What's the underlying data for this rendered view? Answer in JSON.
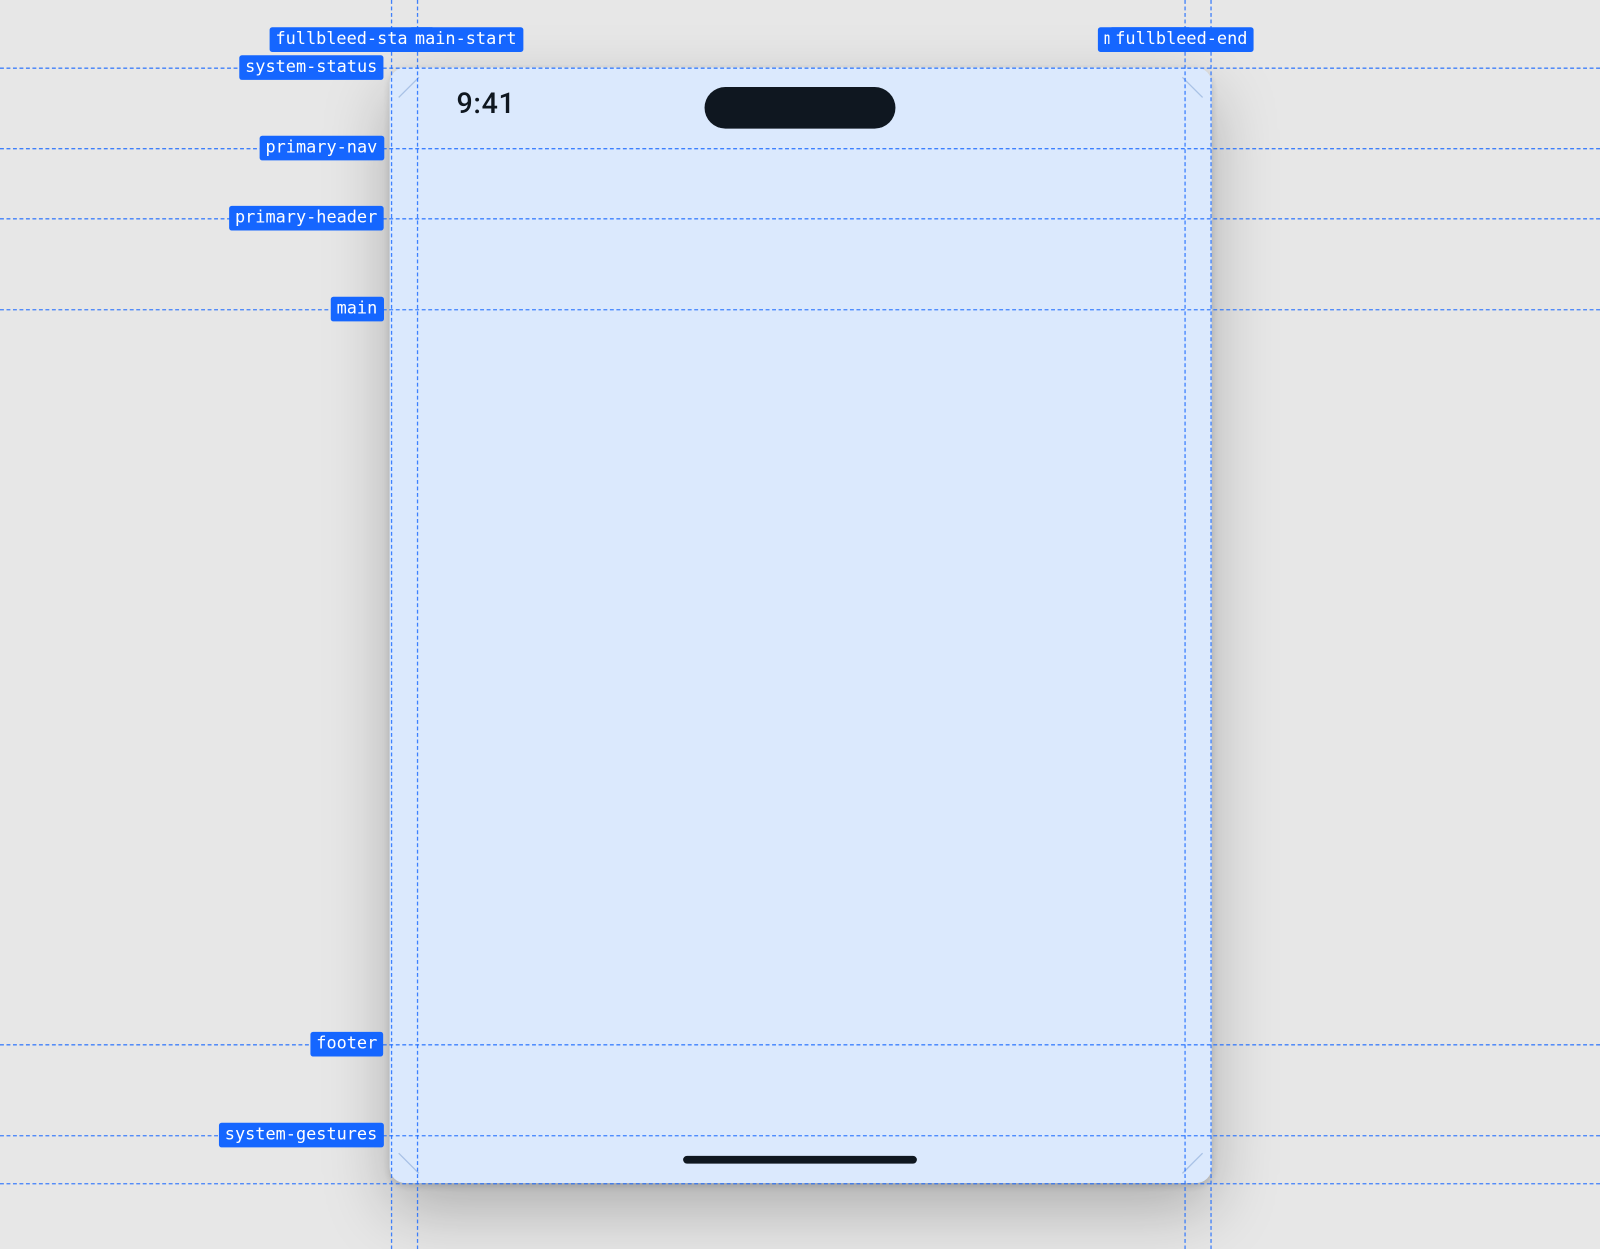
{
  "status": {
    "time": "9:41"
  },
  "guides": {
    "vertical": {
      "full_bleed_start": "fullbleed-start",
      "main_start": "main-start",
      "main_end": "main-end",
      "full_bleed_end": "fullbleed-end"
    },
    "horizontal": {
      "system_status": "system-status",
      "primary_nav": "primary-nav",
      "primary_header": "primary-header",
      "main": "main",
      "footer": "footer",
      "system_gestures": "system-gestures"
    }
  }
}
